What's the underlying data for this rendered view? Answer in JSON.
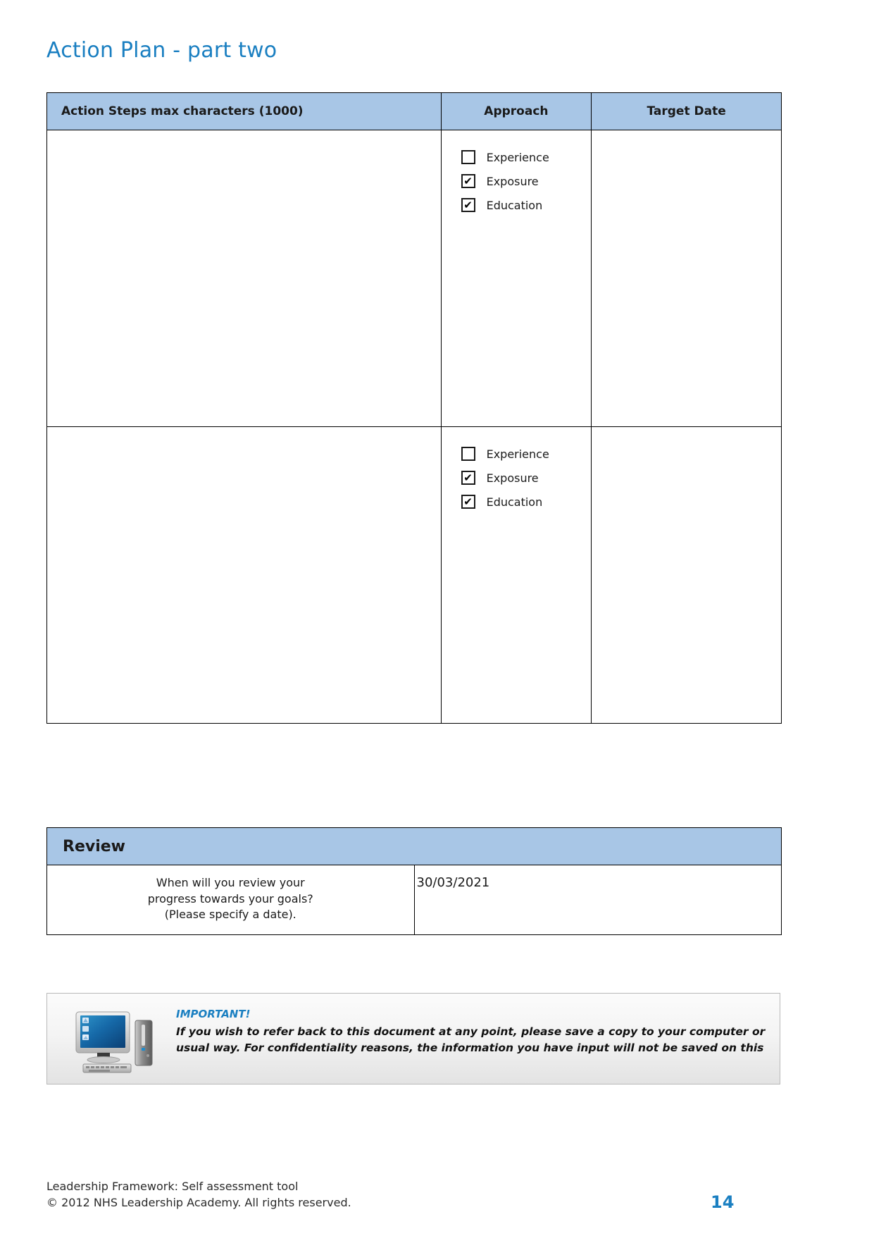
{
  "document": {
    "title": "Action Plan - part two"
  },
  "action_table": {
    "columns": [
      {
        "key": "steps",
        "label": "Action Steps max characters (1000)"
      },
      {
        "key": "approach",
        "label": "Approach"
      },
      {
        "key": "target",
        "label": "Target Date"
      }
    ],
    "rows": [
      {
        "action_steps": "",
        "approach": [
          {
            "label": "Experience",
            "checked": false,
            "mark": ""
          },
          {
            "label": "Exposure",
            "checked": true,
            "mark": "✔"
          },
          {
            "label": "Education",
            "checked": true,
            "mark": "✔"
          }
        ],
        "target_date": ""
      },
      {
        "action_steps": "",
        "approach": [
          {
            "label": "Experience",
            "checked": false,
            "mark": ""
          },
          {
            "label": "Exposure",
            "checked": true,
            "mark": "✔"
          },
          {
            "label": "Education",
            "checked": true,
            "mark": "✔"
          }
        ],
        "target_date": ""
      }
    ]
  },
  "review": {
    "header": "Review",
    "question_line1": "When will you review your",
    "question_line2": "progress towards your goals?",
    "question_line3": "(Please specify a date).",
    "answer_date": "30/03/2021"
  },
  "notice": {
    "important_label": "IMPORTANT!",
    "line1": "If you wish to refer back to this document at any point, please save a copy to your computer or",
    "line2": "usual way. For confidentiality reasons, the information you have input will not be saved on this",
    "icon": "desktop-computer-icon"
  },
  "footer": {
    "line1": "Leadership Framework: Self assessment tool",
    "line2": "© 2012 NHS Leadership Academy.  All rights reserved.",
    "page_number": "14"
  },
  "colors": {
    "title_blue": "#1a7fc1",
    "header_fill": "#a8c6e6",
    "border": "#000000",
    "notice_accent": "#1a7fc1"
  }
}
